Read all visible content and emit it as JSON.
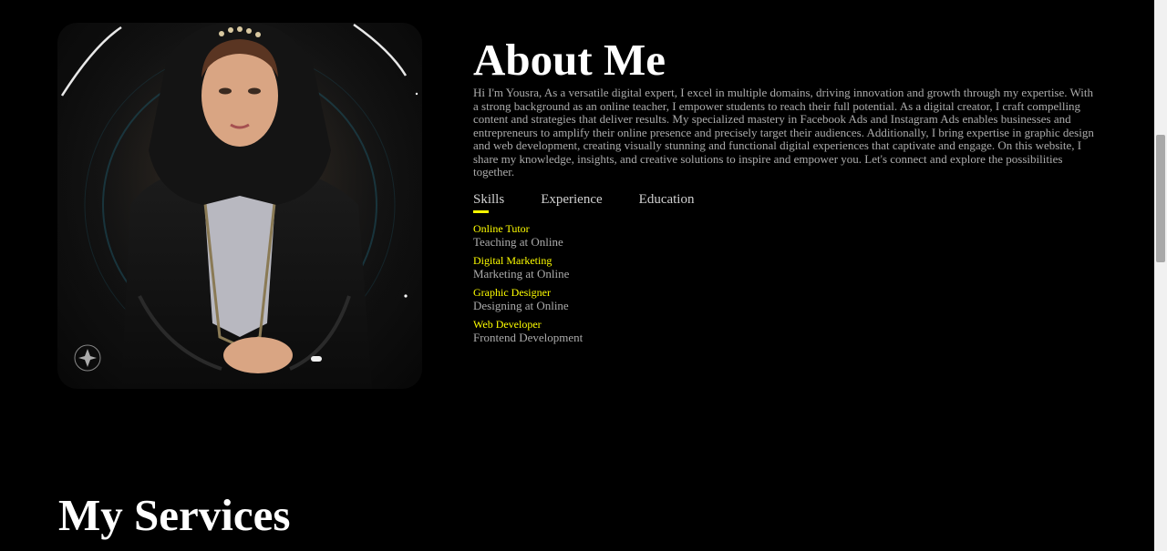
{
  "about": {
    "title": "About Me",
    "text": "Hi I'm Yousra, As a versatile digital expert, I excel in multiple domains, driving innovation and growth through my expertise. With a strong background as an online teacher, I empower students to reach their full potential. As a digital creator, I craft compelling content and strategies that deliver results. My specialized mastery in Facebook Ads and Instagram Ads enables businesses and entrepreneurs to amplify their online presence and precisely target their audiences. Additionally, I bring expertise in graphic design and web development, creating visually stunning and functional digital experiences that captivate and engage. On this website, I share my knowledge, insights, and creative solutions to inspire and empower you. Let's connect and explore the possibilities together."
  },
  "tabs": [
    {
      "label": "Skills",
      "active": true
    },
    {
      "label": "Experience",
      "active": false
    },
    {
      "label": "Education",
      "active": false
    }
  ],
  "skills": [
    {
      "title": "Online Tutor",
      "subtitle": "Teaching at Online"
    },
    {
      "title": "Digital Marketing",
      "subtitle": "Marketing at Online"
    },
    {
      "title": "Graphic Designer",
      "subtitle": "Designing at Online"
    },
    {
      "title": "Web Developer",
      "subtitle": "Frontend Development"
    }
  ],
  "services": {
    "title": "My Services"
  },
  "colors": {
    "background": "#000000",
    "accent": "#ffff00",
    "heading": "#ffffff",
    "body_text": "#ababab"
  },
  "icons": {
    "portrait": "profile-photo"
  }
}
